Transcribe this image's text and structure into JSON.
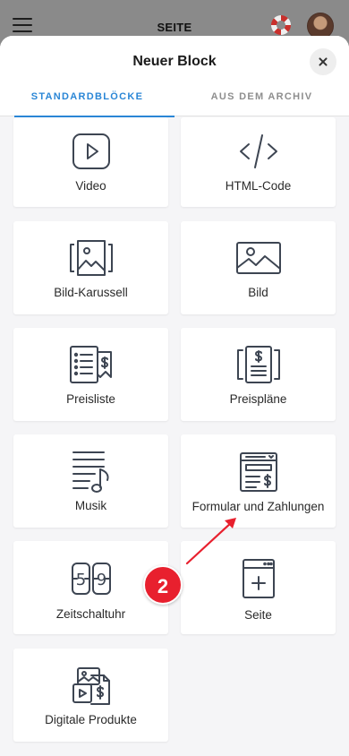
{
  "topbar": {
    "title": "SEITE"
  },
  "sheet": {
    "title": "Neuer Block"
  },
  "tabs": [
    {
      "label": "STANDARDBLÖCKE",
      "active": true
    },
    {
      "label": "AUS DEM ARCHIV",
      "active": false
    }
  ],
  "blocks": [
    {
      "label": "Video",
      "icon": "play-icon"
    },
    {
      "label": "HTML-Code",
      "icon": "code-icon"
    },
    {
      "label": "Bild-Karussell",
      "icon": "image-carousel-icon"
    },
    {
      "label": "Bild",
      "icon": "image-icon"
    },
    {
      "label": "Preisliste",
      "icon": "price-list-icon"
    },
    {
      "label": "Preispläne",
      "icon": "price-plans-icon"
    },
    {
      "label": "Musik",
      "icon": "music-icon"
    },
    {
      "label": "Formular und Zahlungen",
      "icon": "form-payment-icon"
    },
    {
      "label": "Zeitschaltuhr",
      "icon": "timer-icon"
    },
    {
      "label": "Seite",
      "icon": "add-page-icon"
    },
    {
      "label": "Digitale Produkte",
      "icon": "digital-products-icon"
    }
  ],
  "annotation": {
    "badge": "2"
  },
  "colors": {
    "accent": "#2a86d6",
    "badge": "#e8202e",
    "icon_stroke": "#3d4552"
  }
}
